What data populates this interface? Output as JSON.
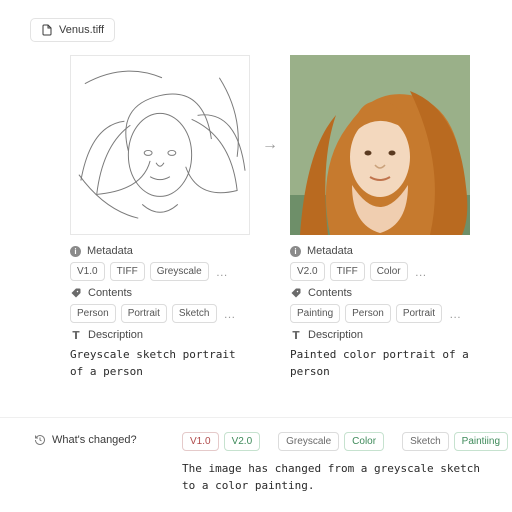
{
  "file": {
    "name": "Venus.tiff"
  },
  "arrow_glyph": "→",
  "ellipsis_glyph": "…",
  "sections": {
    "metadata": "Metadata",
    "contents": "Contents",
    "description": "Description"
  },
  "left": {
    "metadata_tags": [
      "V1.0",
      "TIFF",
      "Greyscale"
    ],
    "contents_tags": [
      "Person",
      "Portrait",
      "Sketch"
    ],
    "description": "Greyscale sketch portrait of a person"
  },
  "right": {
    "metadata_tags": [
      "V2.0",
      "TIFF",
      "Color"
    ],
    "contents_tags": [
      "Painting",
      "Person",
      "Portrait"
    ],
    "description": "Painted color portrait of a person"
  },
  "changed": {
    "label": "What's changed?",
    "pairs": [
      {
        "from": "V1.0",
        "to": "V2.0"
      },
      {
        "from": "Greyscale",
        "to": "Color"
      },
      {
        "from": "Sketch",
        "to": "Paintiing"
      }
    ],
    "summary": "The image has changed from a greyscale sketch to a color painting."
  }
}
